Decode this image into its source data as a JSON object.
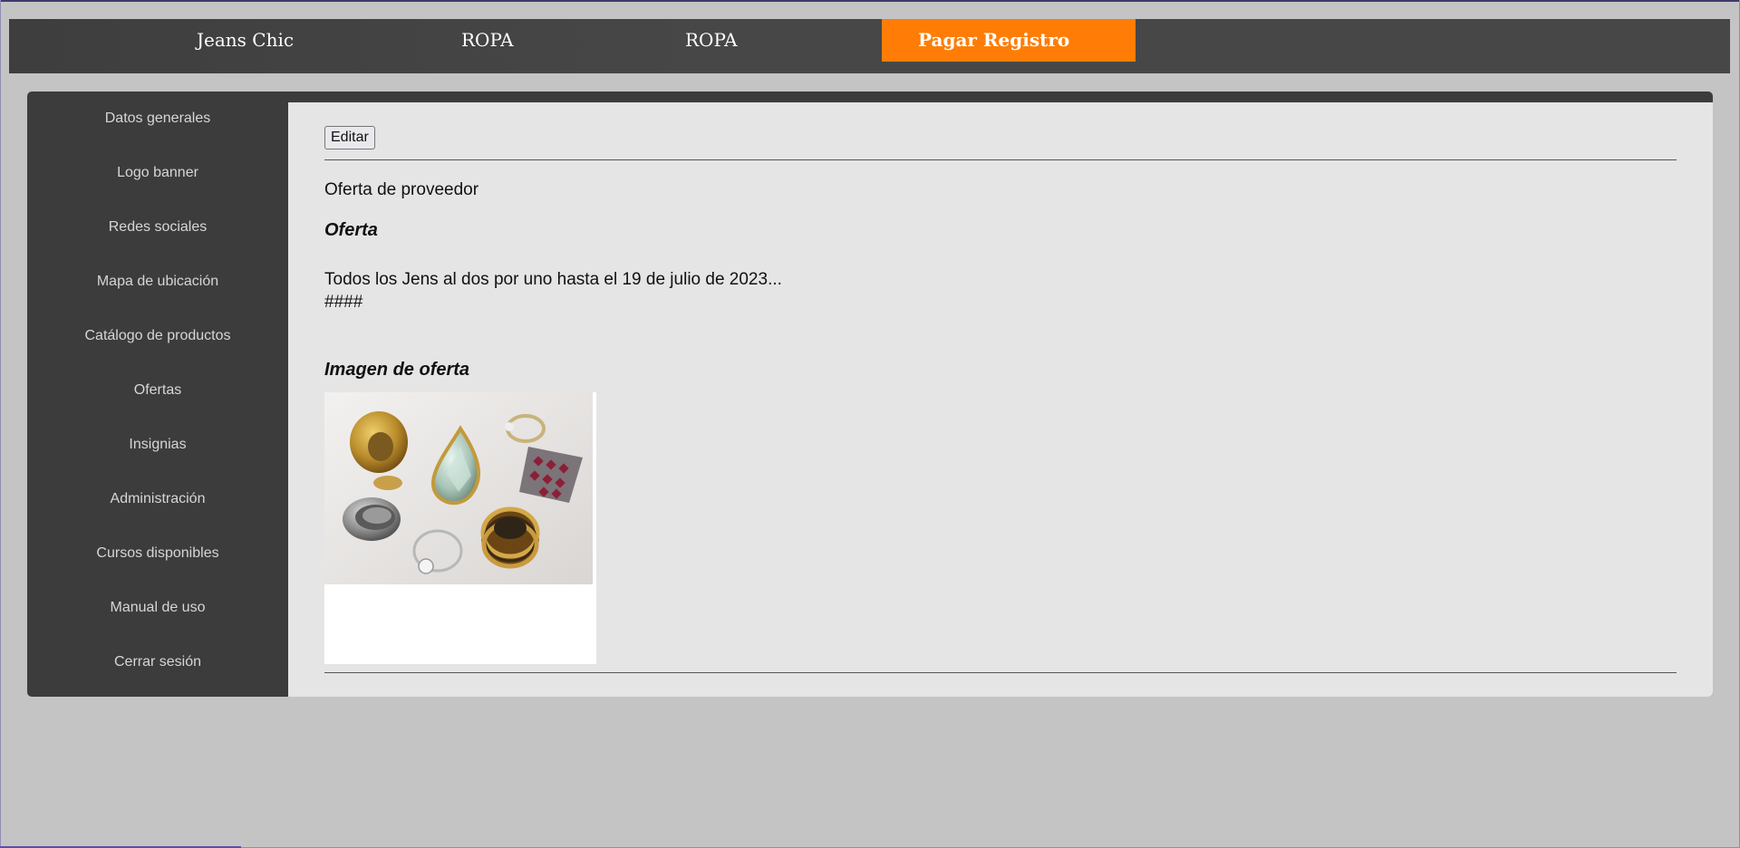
{
  "nav": {
    "brand": "Jeans Chic",
    "item1": "ROPA",
    "item2": "ROPA",
    "pay": "Pagar Registro"
  },
  "sidebar": {
    "items": [
      {
        "label": "Datos generales"
      },
      {
        "label": "Logo banner"
      },
      {
        "label": "Redes sociales"
      },
      {
        "label": "Mapa de ubicación"
      },
      {
        "label": "Catálogo de productos"
      },
      {
        "label": "Ofertas"
      },
      {
        "label": "Insignias"
      },
      {
        "label": "Administración"
      },
      {
        "label": "Cursos disponibles"
      },
      {
        "label": "Manual de uso"
      },
      {
        "label": "Cerrar sesión"
      }
    ]
  },
  "main": {
    "edit_label": "Editar",
    "subtitle": "Oferta de proveedor",
    "offer_heading": "Oferta",
    "offer_text": "Todos los Jens al dos por uno hasta el 19 de julio de 2023...",
    "offer_hashes": "####",
    "image_heading": "Imagen de oferta"
  },
  "colors": {
    "accent": "#ff7d06",
    "navbar": "#474747",
    "sidebar": "#3c3c3c",
    "content_bg": "#e5e5e5",
    "page_bg": "#c4c4c4"
  }
}
